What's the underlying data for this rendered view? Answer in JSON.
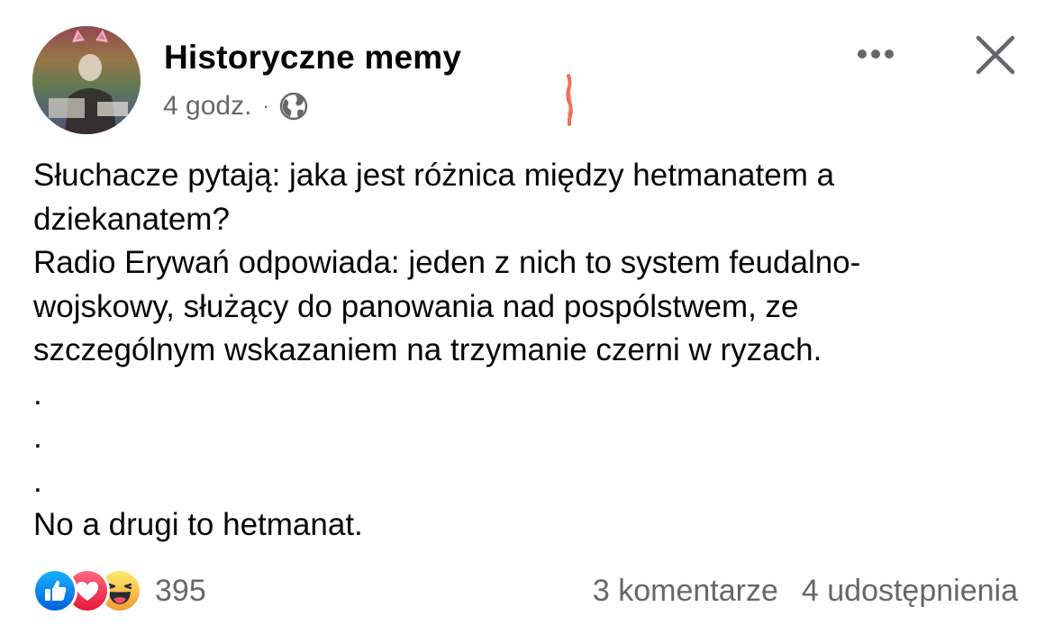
{
  "header": {
    "page_name": "Historyczne memy",
    "timestamp": "4 godz.",
    "separator": "·",
    "audience_icon": "globe-icon",
    "more_icon": "more-dots-icon",
    "close_icon": "close-icon"
  },
  "post": {
    "lines": [
      "Słuchacze pytają: jaka jest różnica między hetmanatem a",
      "dziekanatem?",
      "Radio Erywań odpowiada: jeden z nich to system feudalno-",
      "wojskowy, służący do panowania nad pospólstwem, ze",
      "szczególnym wskazaniem na trzymanie czerni w ryzach.",
      ".",
      ".",
      ".",
      "No a drugi to hetmanat."
    ]
  },
  "footer": {
    "reactions": [
      "like-icon",
      "love-icon",
      "haha-icon"
    ],
    "reaction_count": "395",
    "comments": "3 komentarze",
    "shares": "4 udostępnienia"
  },
  "colors": {
    "text_primary": "#050505",
    "text_secondary": "#65676b",
    "like_blue": "#1877f2",
    "love_red": "#f33e58",
    "haha_yellow": "#f7b125"
  }
}
